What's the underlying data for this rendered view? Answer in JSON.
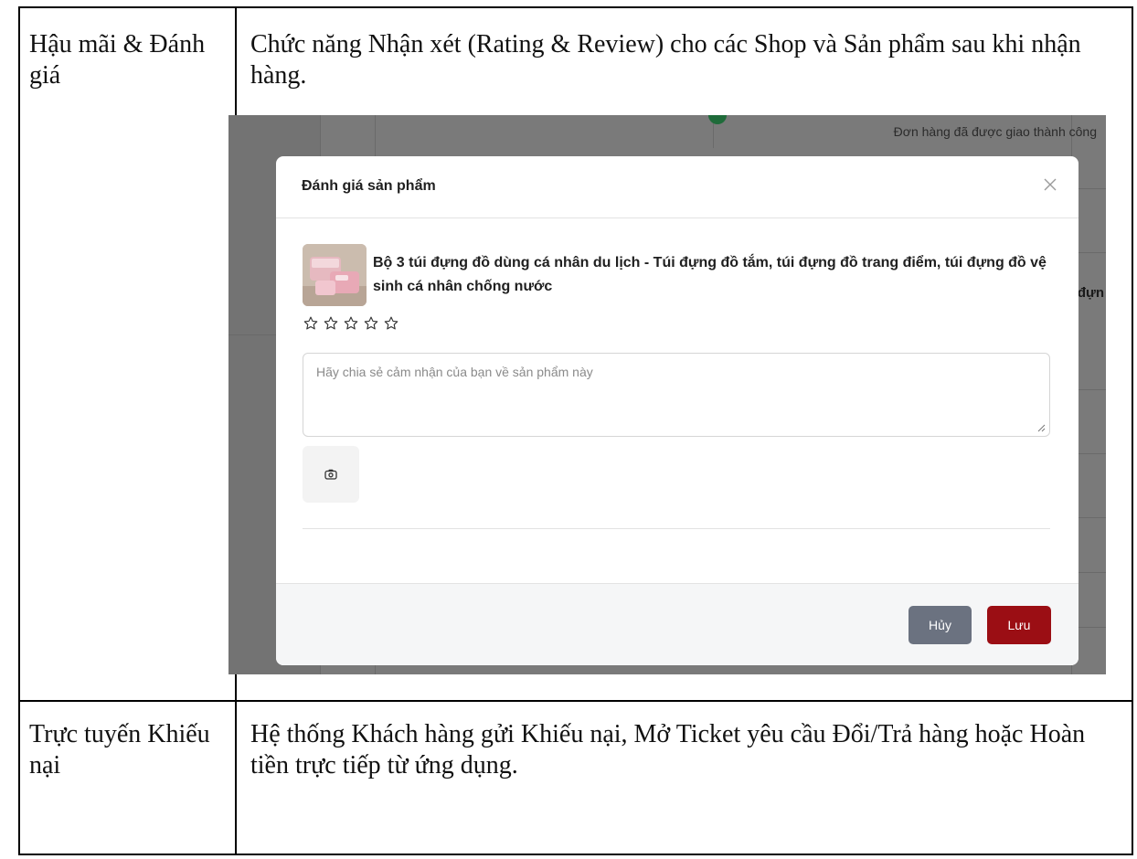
{
  "table": {
    "rows": [
      {
        "category": "Hậu mãi & Đánh giá",
        "description": "Chức năng Nhận xét (Rating & Review) cho các Shop và Sản phẩm sau khi nhận hàng."
      },
      {
        "category": "Trực tuyến Khiếu nại",
        "description": "Hệ thống Khách hàng gửi Khiếu nại, Mở Ticket yêu cầu Đổi/Trả hàng hoặc Hoàn tiền trực tiếp từ ứng dụng."
      }
    ]
  },
  "screenshot": {
    "background": {
      "order_status": "Đơn hàng đã được giao thành công",
      "cut_text": "đựn"
    },
    "modal": {
      "title": "Đánh giá sản phẩm",
      "product_name": "Bộ 3 túi đựng đồ dùng cá nhân du lịch - Túi đựng đồ tắm, túi đựng đồ trang điểm, túi đựng đồ vệ sinh cá nhân chống nước",
      "rating": {
        "value": 0,
        "max": 5
      },
      "review_placeholder": "Hãy chia sẻ cảm nhận của bạn về sản phẩm này",
      "cancel_label": "Hủy",
      "save_label": "Lưu"
    },
    "colors": {
      "save_button": "#9b0e14",
      "cancel_button": "#6b7280",
      "overlay": "#7a7a7a"
    },
    "icons": [
      "close-icon",
      "star-outline-icon",
      "camera-icon"
    ]
  }
}
